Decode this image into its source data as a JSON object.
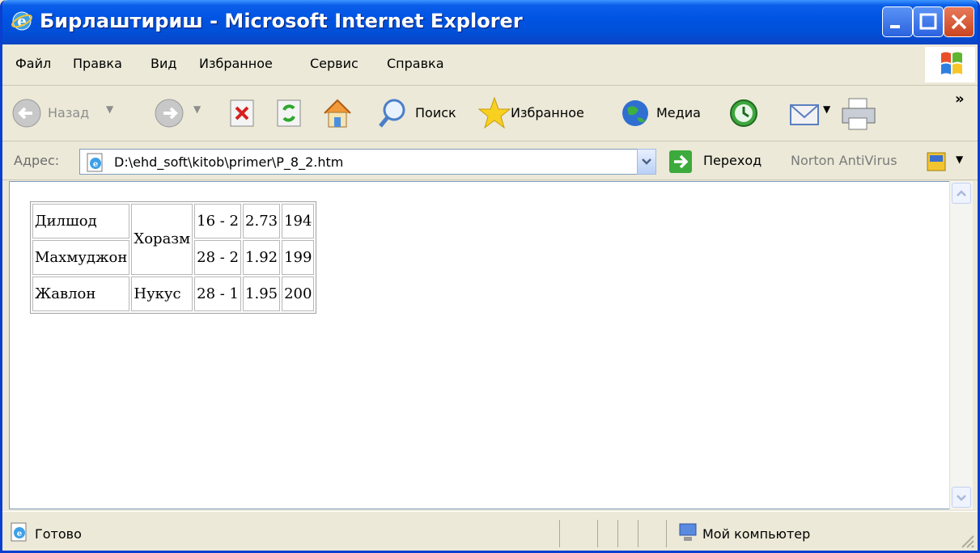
{
  "window": {
    "title": "Бирлаштириш - Microsoft Internet Explorer"
  },
  "menu": [
    "Файл",
    "Правка",
    "Вид",
    "Избранное",
    "Сервис",
    "Справка"
  ],
  "toolbar": {
    "back": "Назад",
    "search": "Поиск",
    "favorites": "Избранное",
    "media": "Медиа"
  },
  "address": {
    "label": "Адрес:",
    "value": "D:\\ehd_soft\\kitob\\primer\\P_8_2.htm",
    "go": "Переход",
    "norton": "Norton AntiVirus"
  },
  "table": {
    "rows": [
      {
        "name": "Дилшод",
        "city": "Хоразм",
        "c3": "16 - 2",
        "c4": "2.73",
        "c5": "194"
      },
      {
        "name": "Махмуджон",
        "c3": "28 - 2",
        "c4": "1.92",
        "c5": "199"
      },
      {
        "name": "Жавлон",
        "city": "Нукус",
        "c3": "28 - 1",
        "c4": "1.95",
        "c5": "200"
      }
    ]
  },
  "status": {
    "text": "Готово",
    "zone": "Мой компьютер"
  }
}
